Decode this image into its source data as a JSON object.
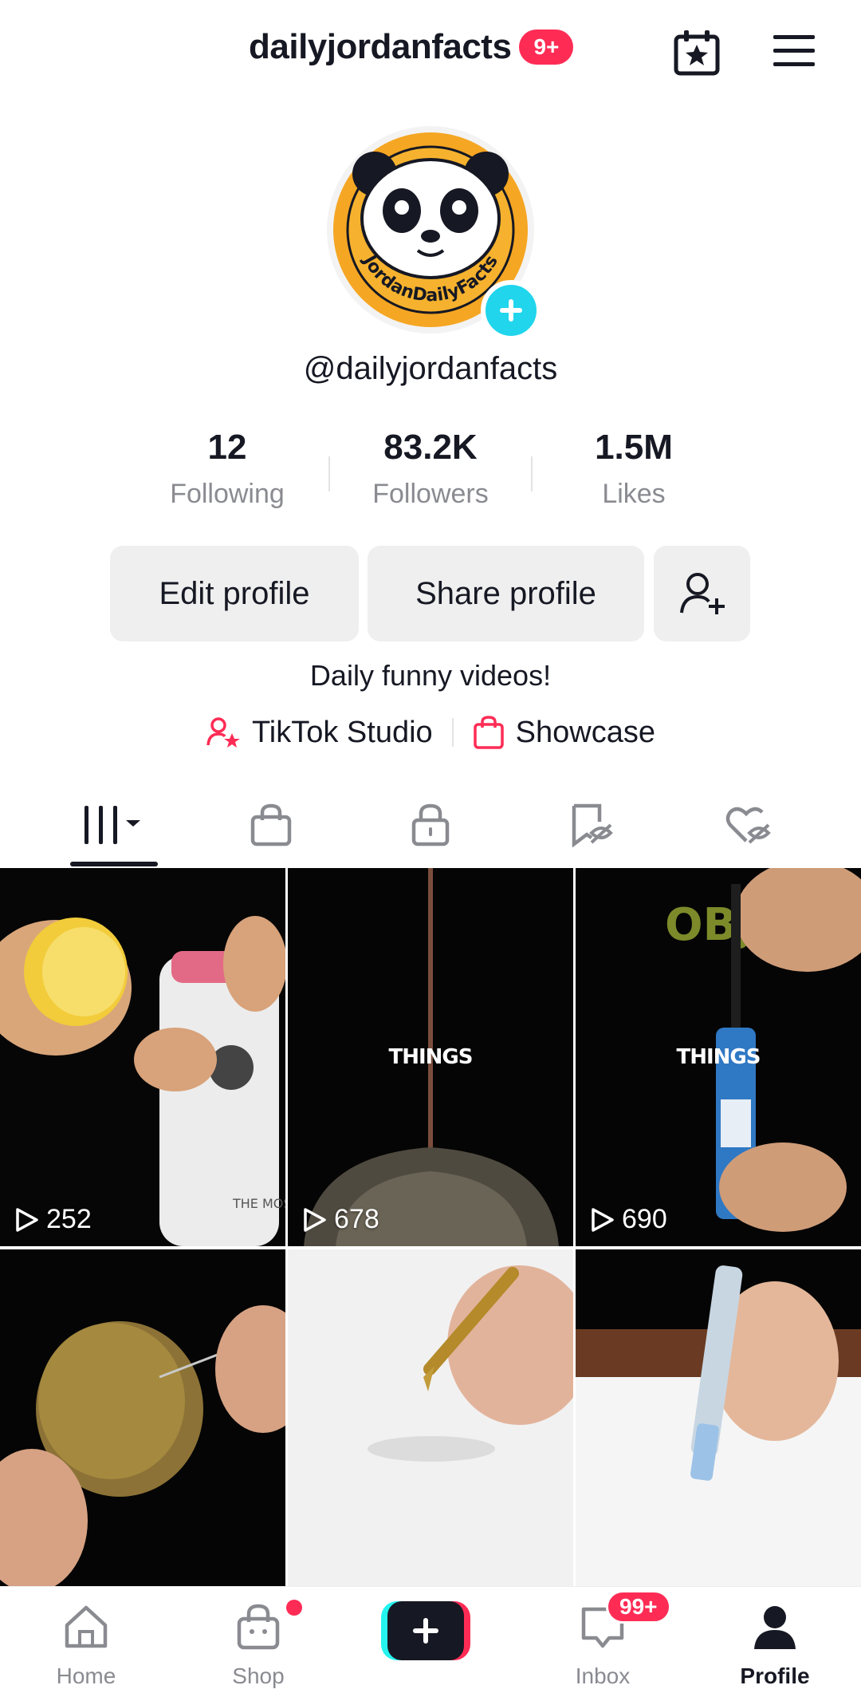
{
  "header": {
    "username": "dailyjordanfacts",
    "notif_badge": "9+",
    "calendar_icon": "calendar-star-icon",
    "menu_icon": "hamburger-menu-icon"
  },
  "profile": {
    "avatar_label": "JordanDailyFacts",
    "handle": "@dailyjordanfacts",
    "stats": [
      {
        "value": "12",
        "label": "Following"
      },
      {
        "value": "83.2K",
        "label": "Followers"
      },
      {
        "value": "1.5M",
        "label": "Likes"
      }
    ],
    "edit_label": "Edit profile",
    "share_label": "Share profile",
    "bio": "Daily funny videos!",
    "studio_label": "TikTok Studio",
    "showcase_label": "Showcase"
  },
  "tabs": [
    {
      "icon": "videos-grid-icon"
    },
    {
      "icon": "shopping-bag-icon"
    },
    {
      "icon": "lock-icon"
    },
    {
      "icon": "bookmark-hidden-icon"
    },
    {
      "icon": "liked-hidden-icon"
    }
  ],
  "videos": [
    {
      "views": "252",
      "overlay": ""
    },
    {
      "views": "678",
      "overlay": "THINGS"
    },
    {
      "views": "690",
      "overlay": "THINGS"
    },
    {
      "views": "",
      "overlay": ""
    },
    {
      "views": "",
      "overlay": ""
    },
    {
      "views": "",
      "overlay": ""
    }
  ],
  "video_overlay_extras": {
    "cell3_top_text": "OBJE",
    "cell1_corner_text": "THE MOS VERSAT"
  },
  "bottom_nav": [
    {
      "label": "Home"
    },
    {
      "label": "Shop"
    },
    {
      "label": ""
    },
    {
      "label": "Inbox",
      "badge": "99+"
    },
    {
      "label": "Profile"
    }
  ],
  "colors": {
    "accent_red": "#fe2c55",
    "accent_cyan": "#20d5ec",
    "text_primary": "#161823",
    "text_secondary": "#8a8b91"
  }
}
